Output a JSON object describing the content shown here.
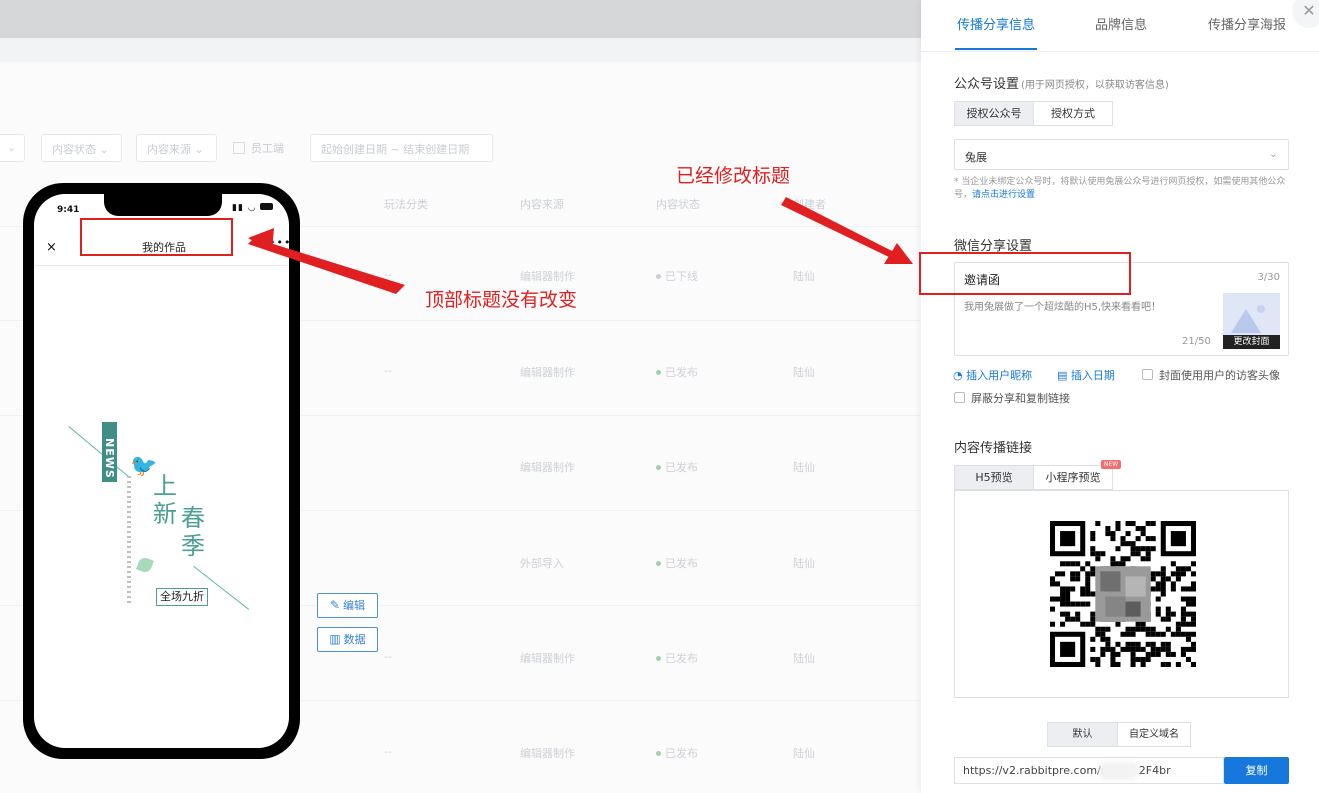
{
  "background_list": {
    "filters": {
      "status": "内容状态",
      "source": "内容来源",
      "staff_checkbox": "员工端",
      "date_range": "起始创建日期 ~ 结束创建日期"
    },
    "columns": [
      "玩法分类",
      "内容来源",
      "内容状态",
      "创建者"
    ],
    "rows": [
      {
        "category": "--",
        "source": "编辑器制作",
        "status": "已下线",
        "creator": "陆仙"
      },
      {
        "category": "--",
        "source": "编辑器制作",
        "status": "已发布",
        "creator": "陆仙"
      },
      {
        "category": "",
        "source": "编辑器制作",
        "status": "已发布",
        "creator": "陆仙"
      },
      {
        "category": "",
        "source": "外部导入",
        "status": "已发布",
        "creator": "陆仙"
      },
      {
        "category": "--",
        "source": "编辑器制作",
        "status": "已发布",
        "creator": "陆仙"
      },
      {
        "category": "--",
        "source": "编辑器制作",
        "status": "已发布",
        "creator": "陆仙"
      }
    ],
    "edit_label": "编辑",
    "data_label": "数据"
  },
  "phone": {
    "time": "9:41",
    "title": "我的作品",
    "close_icon": "×",
    "poster": {
      "news": "NEWS",
      "char_1": "上",
      "char_2": "新",
      "char_3": "春",
      "char_4": "季",
      "discount": "全场九折"
    }
  },
  "annotations": {
    "left_note": "顶部标题没有改变",
    "right_note": "已经修改标题",
    "color": "#e02020"
  },
  "panel": {
    "tabs": [
      "传播分享信息",
      "品牌信息",
      "传播分享海报"
    ],
    "close_icon": "✕",
    "official_account": {
      "title": "公众号设置",
      "note": "(用于网页授权，以获取访客信息)",
      "seg_options": [
        "授权公众号",
        "授权方式"
      ],
      "select_value": "兔展",
      "hint": "* 当企业未绑定公众号时，将默认使用兔展公众号进行网页授权，如需使用其他公众号，",
      "hint_link": "请点击进行设置"
    },
    "wechat_share": {
      "title": "微信分享设置",
      "share_title": "邀请函",
      "title_count": "3/30",
      "description": "我用兔展做了一个超炫酷的H5,快来看看吧！",
      "desc_count": "21/50",
      "change_cover": "更改封面",
      "insert_nickname": "插入用户昵称",
      "insert_date": "插入日期",
      "use_avatar": "封面使用用户的访客头像",
      "block_share": "屏蔽分享和复制链接"
    },
    "content_link": {
      "title": "内容传播链接",
      "tabs": [
        "H5预览",
        "小程序预览"
      ],
      "new_badge": "NEW",
      "domain_options": [
        "默认",
        "自定义域名"
      ],
      "url": "https://v2.rabbitpre.com/m2/FS         2F4br",
      "copy_label": "复制"
    },
    "accent_color": "#1677dd"
  }
}
